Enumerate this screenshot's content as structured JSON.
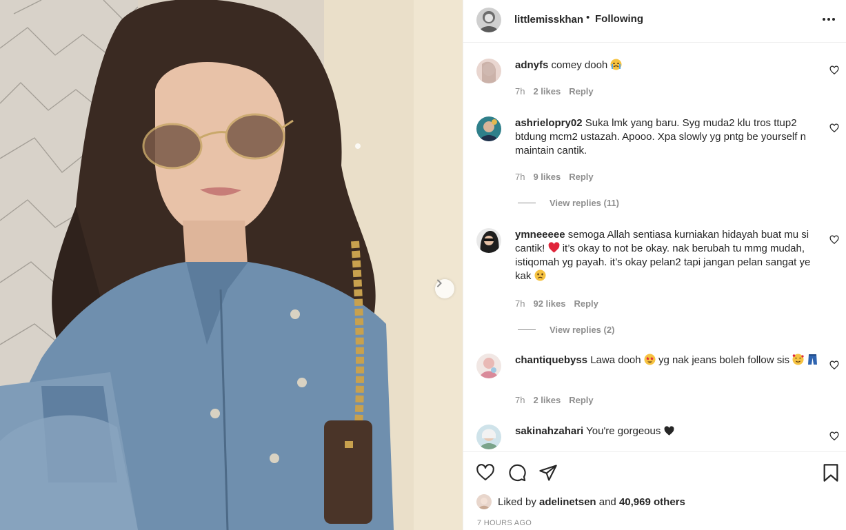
{
  "post": {
    "username": "littlemisskhan",
    "separator": "•",
    "follow_status": "Following",
    "more_icon": "more-horizontal-icon"
  },
  "comments": [
    {
      "user": "adnyfs",
      "text": "comey dooh",
      "emoji": "crying-face",
      "time": "7h",
      "likes": "2 likes",
      "reply": "Reply"
    },
    {
      "user": "ashrielopry02",
      "text": "Suka lmk yang baru. Syg muda2 klu tros ttup2 btdung mcm2 ustazah. Apooo. Xpa slowly yg pntg be yourself n maintain cantik.",
      "time": "7h",
      "likes": "9 likes",
      "reply": "Reply",
      "view_replies": "View replies (11)"
    },
    {
      "user": "ymneeeee",
      "text_a": "semoga Allah sentiasa kurniakan hidayah buat mu si cantik!",
      "text_b": "it’s okay to not be okay. nak berubah tu mmg mudah, istiqomah yg payah. it’s okay pelan2 tapi jangan pelan sangat ye kak",
      "time": "7h",
      "likes": "92 likes",
      "reply": "Reply",
      "view_replies": "View replies (2)"
    },
    {
      "user": "chantiquebyss",
      "text_a": "Lawa dooh",
      "text_b": "yg nak jeans boleh follow sis",
      "time": "7h",
      "likes": "2 likes",
      "reply": "Reply"
    },
    {
      "user": "sakinahzahari",
      "text": "You're gorgeous"
    }
  ],
  "likes": {
    "prefix": "Liked by",
    "user": "adelinetsen",
    "middle": "and",
    "others": "40,969 others"
  },
  "timestamp": "7 HOURS AGO",
  "colors": {
    "text": "#262626",
    "muted": "#8e8e8e",
    "border": "#efefef",
    "heart_red": "#ed4956"
  }
}
